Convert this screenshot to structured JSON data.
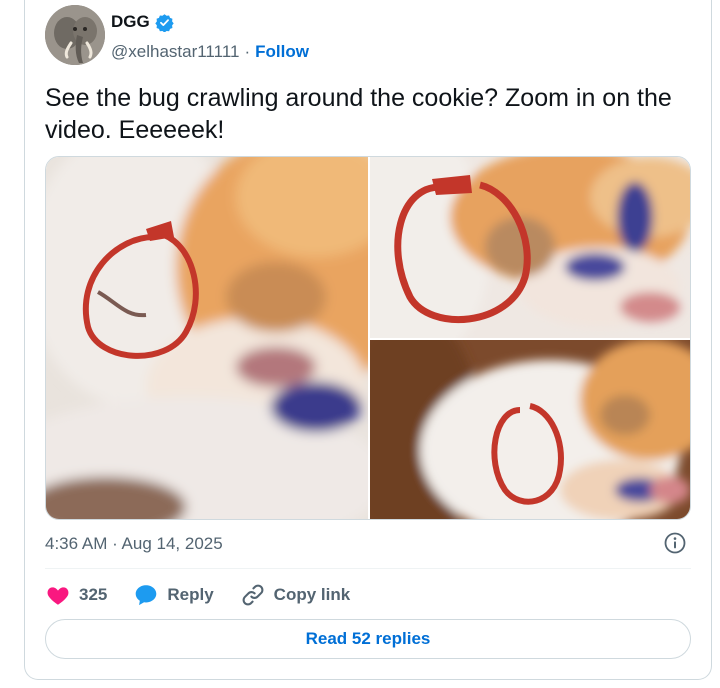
{
  "author": {
    "display_name": "DGG",
    "handle": "@xelhastar11111",
    "separator": "·",
    "follow_label": "Follow"
  },
  "tweet": {
    "text": "See the bug crawling around the cookie? Zoom in on the video. Eeeeeek!",
    "timestamp": "4:36 AM · Aug 14, 2025"
  },
  "actions": {
    "like_count": "325",
    "reply_label": "Reply",
    "copy_link_label": "Copy link",
    "read_replies_label": "Read 52 replies"
  },
  "colors": {
    "like": "#f91880",
    "reply": "#1d9bf0",
    "link": "#006fd6",
    "verified": "#1d9bf0"
  }
}
